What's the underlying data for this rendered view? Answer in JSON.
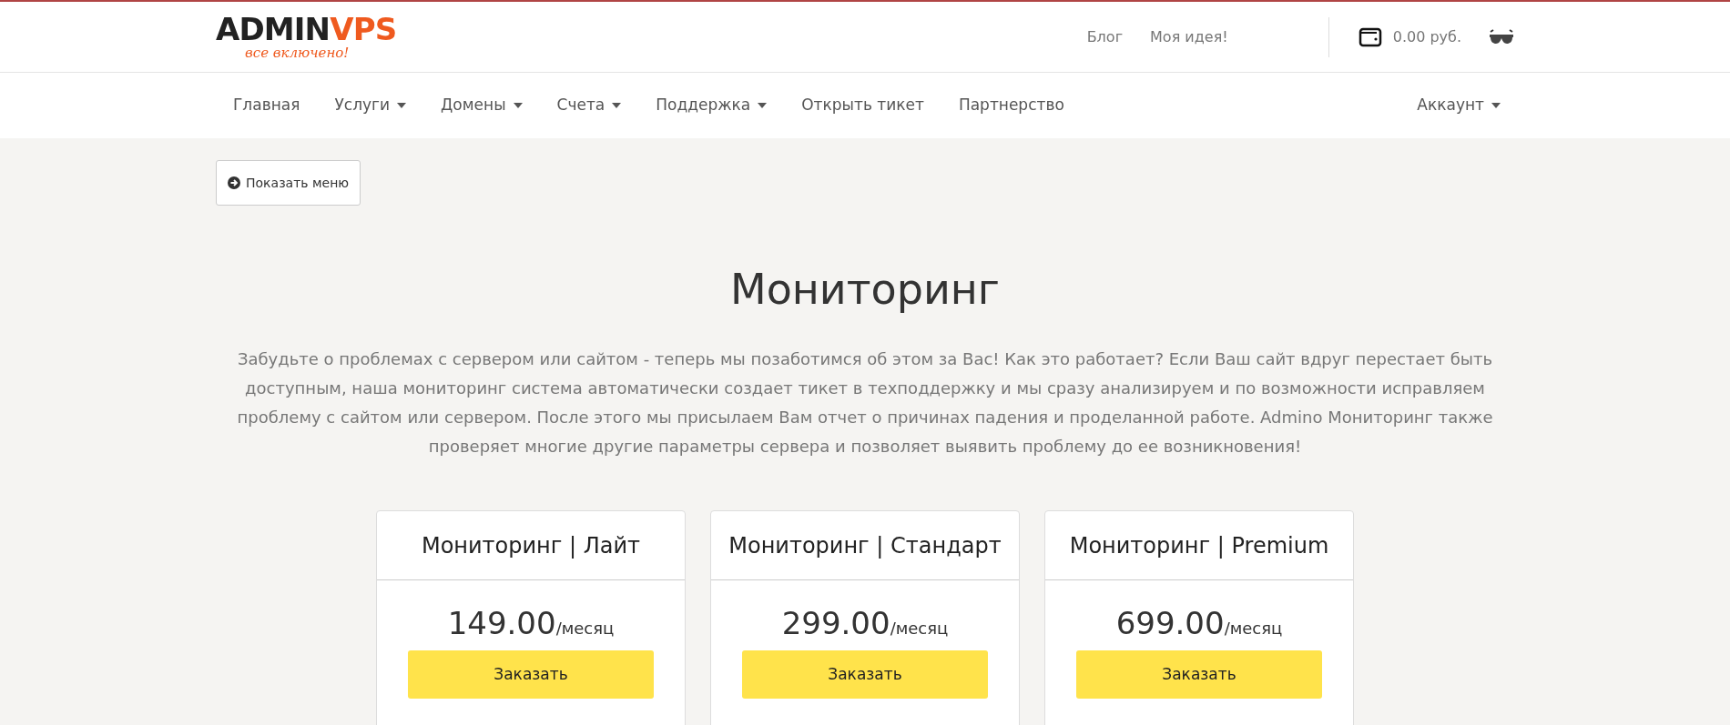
{
  "logo": {
    "name_dark": "ADMIN",
    "name_accent": "VPS",
    "tagline": "все включено!"
  },
  "top_links": [
    "Блог",
    "Моя идея!"
  ],
  "balance": "0.00 руб.",
  "nav": {
    "items": [
      {
        "label": "Главная",
        "dropdown": false
      },
      {
        "label": "Услуги",
        "dropdown": true
      },
      {
        "label": "Домены",
        "dropdown": true
      },
      {
        "label": "Счета",
        "dropdown": true
      },
      {
        "label": "Поддержка",
        "dropdown": true
      },
      {
        "label": "Открыть тикет",
        "dropdown": false
      },
      {
        "label": "Партнерство",
        "dropdown": false
      }
    ],
    "account": {
      "label": "Аккаунт",
      "dropdown": true
    }
  },
  "show_menu_button": "Показать меню",
  "title": "Мониторинг",
  "description": "Забудьте о проблемах с сервером или сайтом - теперь мы позаботимся об этом за Вас! Как это работает? Если Ваш сайт вдруг перестает быть доступным, наша мониторинг система автоматически создает тикет в техподдержку и мы сразу анализируем и по возможности исправляем проблему с сайтом или сервером. После этого мы присылаем Вам отчет о причинах падения и проделанной работе. Admino Мониторинг также проверяет многие другие параметры сервера и позволяет выявить проблему до ее возникновения!",
  "plans": [
    {
      "name": "Мониторинг | Лайт",
      "price": "149.00",
      "period": "/месяц",
      "button": "Заказать"
    },
    {
      "name": "Мониторинг | Стандарт",
      "price": "299.00",
      "period": "/месяц",
      "button": "Заказать"
    },
    {
      "name": "Мониторинг | Premium",
      "price": "699.00",
      "period": "/месяц",
      "button": "Заказать"
    }
  ]
}
